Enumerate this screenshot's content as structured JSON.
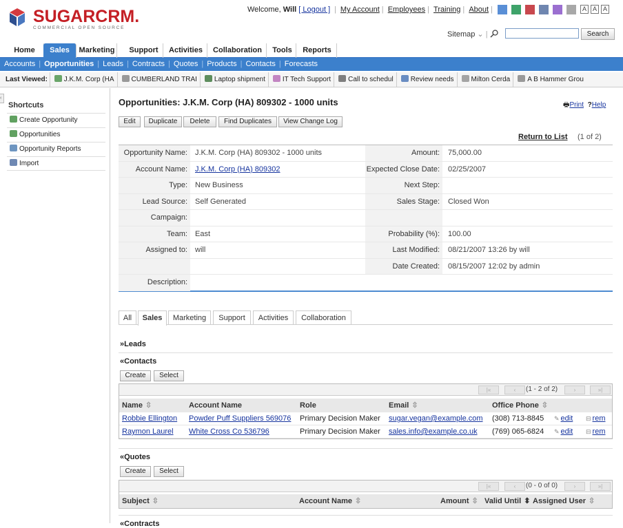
{
  "brand": {
    "name": "SUGARCRM.",
    "tagline": "COMMERCIAL OPEN SOURCE"
  },
  "header": {
    "welcome_prefix": "Welcome,",
    "user": "Will",
    "logout": "[ Logout ]",
    "links": [
      "My Account",
      "Employees",
      "Training",
      "About"
    ],
    "theme_colors": [
      "#5a8fd6",
      "#3ea36a",
      "#c8484e",
      "#6f86b0",
      "#9b6fd0",
      "#a8a8a8"
    ],
    "font_sizes": [
      "A",
      "A",
      "A"
    ],
    "sitemap": "Sitemap",
    "search_button": "Search",
    "search_value": ""
  },
  "tabs": [
    "Home",
    "Sales",
    "Marketing",
    "Support",
    "Activities",
    "Collaboration",
    "Tools",
    "Reports"
  ],
  "active_tab": "Sales",
  "subtabs": [
    "Accounts",
    "Opportunities",
    "Leads",
    "Contracts",
    "Quotes",
    "Products",
    "Contacts",
    "Forecasts"
  ],
  "active_subtab": "Opportunities",
  "last_viewed": {
    "label": "Last Viewed:",
    "items": [
      "J.K.M. Corp (HA",
      "CUMBERLAND TRAI",
      "Laptop shipment",
      "IT Tech Support",
      "Call to schedul",
      "Review needs",
      "Milton Cerda",
      "A B Hammer Grou"
    ]
  },
  "shortcuts": {
    "title": "Shortcuts",
    "items": [
      "Create Opportunity",
      "Opportunities",
      "Opportunity Reports",
      "Import"
    ]
  },
  "page": {
    "title": "Opportunities: J.K.M. Corp (HA) 809302 - 1000 units",
    "print": "Print",
    "help": "Help",
    "buttons": [
      "Edit",
      "Duplicate",
      "Delete",
      "Find Duplicates",
      "View Change Log"
    ],
    "return_to_list": "Return to List",
    "position": "(1 of 2)"
  },
  "detail": {
    "left": [
      {
        "label": "Opportunity Name:",
        "value": "J.K.M. Corp (HA) 809302 - 1000 units"
      },
      {
        "label": "Account Name:",
        "value": "J.K.M. Corp (HA) 809302"
      },
      {
        "label": "Type:",
        "value": "New Business"
      },
      {
        "label": "Lead Source:",
        "value": "Self Generated"
      },
      {
        "label": "Campaign:",
        "value": ""
      },
      {
        "label": "Team:",
        "value": "East"
      },
      {
        "label": "Assigned to:",
        "value": "will"
      },
      {
        "label": "",
        "value": ""
      },
      {
        "label": "Description:",
        "value": ""
      }
    ],
    "right": [
      {
        "label": "Amount:",
        "value": "75,000.00"
      },
      {
        "label": "Expected Close Date:",
        "value": "02/25/2007"
      },
      {
        "label": "Next Step:",
        "value": ""
      },
      {
        "label": "Sales Stage:",
        "value": "Closed Won"
      },
      {
        "label": "",
        "value": ""
      },
      {
        "label": "Probability (%):",
        "value": "100.00"
      },
      {
        "label": "Last Modified:",
        "value": "08/21/2007 13:26 by will"
      },
      {
        "label": "Date Created:",
        "value": "08/15/2007 12:02 by admin"
      }
    ]
  },
  "subpanel_tabs": [
    "All",
    "Sales",
    "Marketing",
    "Support",
    "Activities",
    "Collaboration"
  ],
  "active_subpanel_tab": "Sales",
  "leads": {
    "title": "Leads"
  },
  "contacts": {
    "title": "Contacts",
    "buttons": [
      "Create",
      "Select"
    ],
    "pager": "(1 - 2 of 2)",
    "columns": [
      "Name",
      "Account Name",
      "Role",
      "Email",
      "Office Phone"
    ],
    "rows": [
      {
        "name": "Robbie Ellington",
        "account": "Powder Puff Suppliers 569076",
        "role": "Primary Decision Maker",
        "email": "sugar.vegan@example.com",
        "phone": "(308) 713-8845",
        "edit": "edit",
        "remove": "rem"
      },
      {
        "name": "Raymon Laurel",
        "account": "White Cross Co 536796",
        "role": "Primary Decision Maker",
        "email": "sales.info@example.co.uk",
        "phone": "(769) 065-6824",
        "edit": "edit",
        "remove": "rem"
      }
    ]
  },
  "quotes": {
    "title": "Quotes",
    "buttons": [
      "Create",
      "Select"
    ],
    "pager": "(0 - 0 of 0)",
    "columns": [
      "Subject",
      "Account Name",
      "Amount",
      "Valid Until",
      "Assigned User"
    ]
  },
  "contracts": {
    "title": "Contracts"
  }
}
